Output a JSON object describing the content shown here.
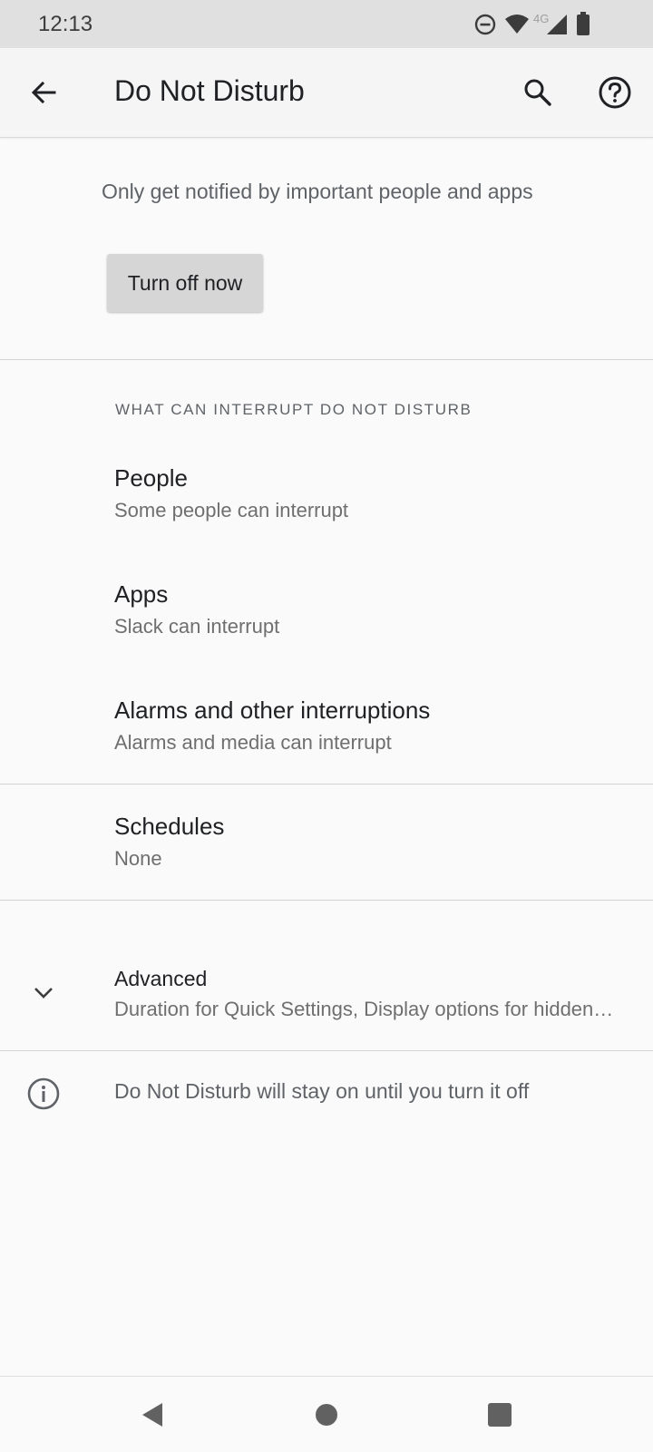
{
  "status_bar": {
    "time": "12:13",
    "network_label": "4G",
    "icons": [
      "dnd-icon",
      "wifi-icon",
      "signal-icon",
      "battery-icon"
    ]
  },
  "app_bar": {
    "title": "Do Not Disturb",
    "icons": [
      "back-arrow-icon",
      "search-icon",
      "help-icon"
    ]
  },
  "intro": {
    "text": "Only get notified by important people and apps",
    "button_label": "Turn off now"
  },
  "section": {
    "header": "WHAT CAN INTERRUPT DO NOT DISTURB",
    "items": [
      {
        "title": "People",
        "summary": "Some people can interrupt"
      },
      {
        "title": "Apps",
        "summary": "Slack can interrupt"
      },
      {
        "title": "Alarms and other interruptions",
        "summary": "Alarms and media can interrupt"
      }
    ]
  },
  "schedules": {
    "title": "Schedules",
    "summary": "None"
  },
  "advanced": {
    "title": "Advanced",
    "summary": "Duration for Quick Settings, Display options for hidden notifications",
    "icon": "chevron-down-icon"
  },
  "footer_info": {
    "text": "Do Not Disturb will stay on until you turn it off",
    "icon": "info-icon"
  },
  "nav_bar": {
    "icons": [
      "nav-back-icon",
      "nav-home-icon",
      "nav-recents-icon"
    ]
  },
  "colors": {
    "status_bar_bg": "#e0e0e0",
    "app_bar_bg": "#f5f5f5",
    "page_bg": "#fafafa",
    "button_bg": "#d6d6d6",
    "primary_text": "#202124",
    "secondary_text": "#5f6368"
  }
}
